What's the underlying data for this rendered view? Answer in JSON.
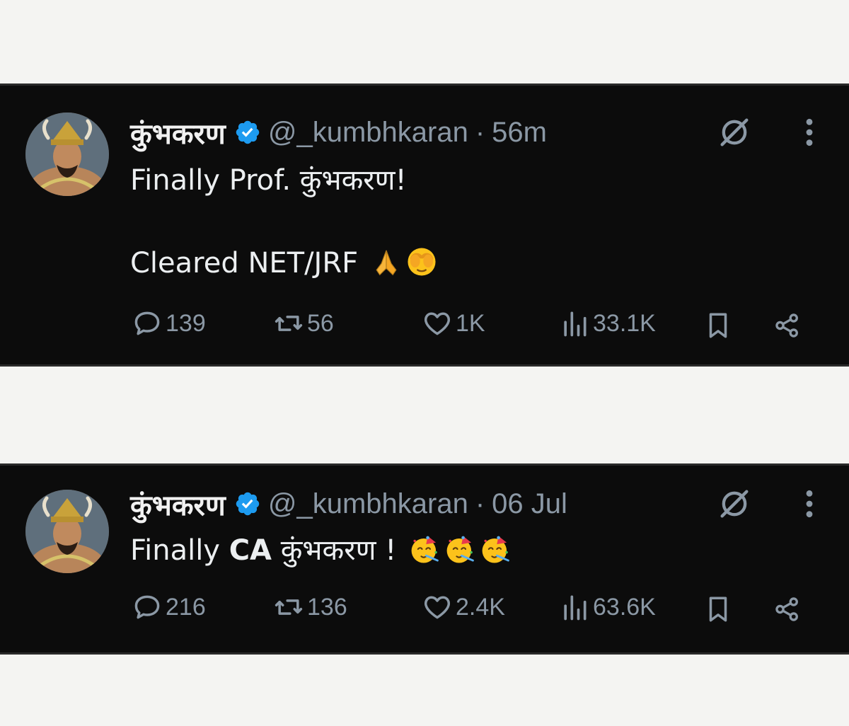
{
  "tweets": [
    {
      "name": "कुंभकरण",
      "handle": "@_kumbhkaran",
      "separator": "·",
      "time": "56m",
      "lines": [
        "Finally Prof. कुंभकरण!",
        "Cleared NET/JRF"
      ],
      "emojis": [
        "folded-hands",
        "face-with-hands-over-eyes"
      ],
      "stats": {
        "replies": "139",
        "reposts": "56",
        "likes": "1K",
        "views": "33.1K"
      }
    },
    {
      "name": "कुंभकरण",
      "handle": "@_kumbhkaran",
      "separator": "·",
      "time": "06 Jul",
      "text_prefix": "Finally ",
      "text_bold": "CA",
      "text_suffix": " कुंभकरण ! ",
      "emojis": [
        "partying-face",
        "partying-face",
        "partying-face"
      ],
      "stats": {
        "replies": "216",
        "reposts": "136",
        "likes": "2.4K",
        "views": "63.6K"
      }
    }
  ],
  "colors": {
    "background": "#0c0c0c",
    "text": "#e7e9ea",
    "muted": "#8b98a5",
    "verified": "#1d9bf0",
    "page": "#f4f4f2"
  }
}
